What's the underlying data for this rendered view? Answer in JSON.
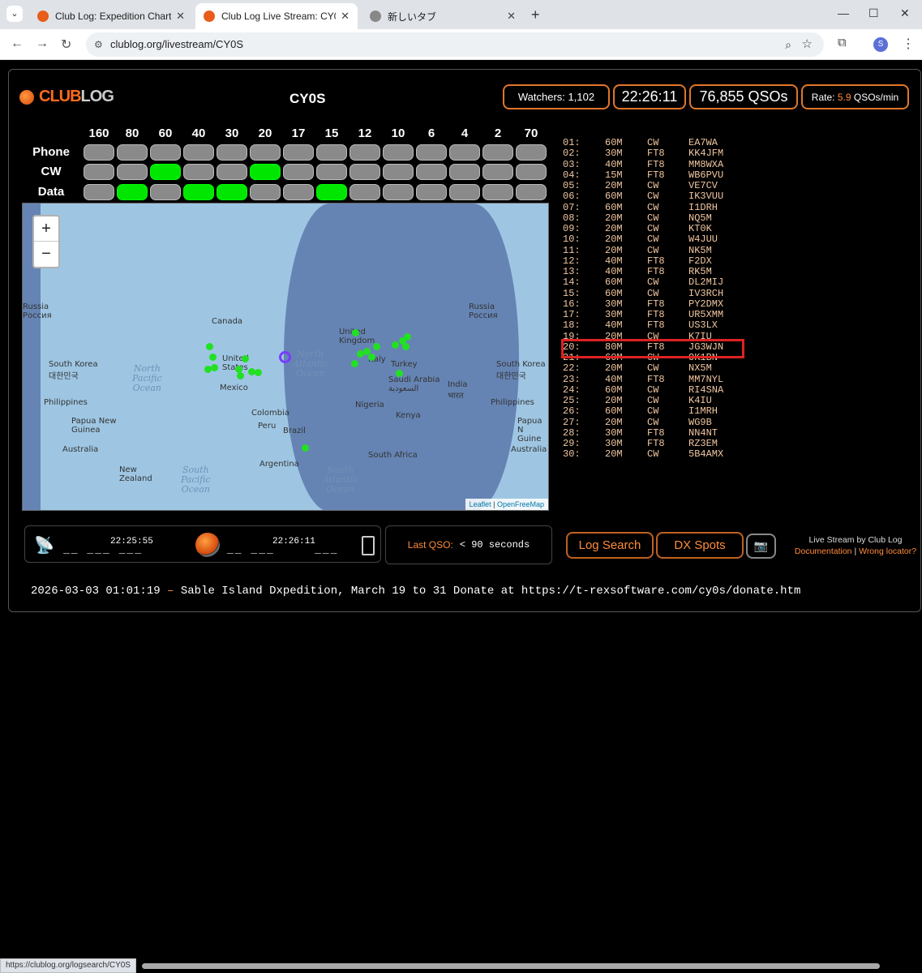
{
  "browser": {
    "tabs": [
      {
        "title": "Club Log: Expedition Charts - C"
      },
      {
        "title": "Club Log Live Stream: CY0S"
      },
      {
        "title": "新しいタブ"
      }
    ],
    "url": "clublog.org/livestream/CY0S",
    "avatar_letter": "S",
    "status_url": "https://clublog.org/logsearch/CY0S"
  },
  "header": {
    "logo_part1": "CLUB",
    "logo_part2": "LOG",
    "callsign": "CY0S",
    "watchers_label": "Watchers:",
    "watchers_value": "1,102",
    "clock": "22:26:11",
    "qso_count": "76,855",
    "qso_unit": "QSOs",
    "rate_label": "Rate:",
    "rate_value": "5.9",
    "rate_unit": "QSOs/min"
  },
  "bands": [
    "160",
    "80",
    "60",
    "40",
    "30",
    "20",
    "17",
    "15",
    "12",
    "10",
    "6",
    "4",
    "2",
    "70"
  ],
  "modes": [
    {
      "label": "Phone",
      "active": []
    },
    {
      "label": "CW",
      "active": [
        "60",
        "20"
      ]
    },
    {
      "label": "Data",
      "active": [
        "80",
        "40",
        "30",
        "15"
      ]
    }
  ],
  "map": {
    "zoom_in": "+",
    "zoom_out": "−",
    "attribution_1": "Leaflet",
    "attribution_sep": "|",
    "attribution_2": "OpenFreeMap",
    "labels": {
      "russia_w": "Russia\nРоссия",
      "south_korea_w": "South Korea\n대한민국",
      "philippines_w": "Philippines",
      "png_w": "Papua New\nGuinea",
      "australia_w": "Australia",
      "new_zealand": "New\nZealand",
      "canada": "Canada",
      "united_states": "United\nStates",
      "mexico": "Mexico",
      "colombia": "Colombia",
      "peru": "Peru",
      "brazil": "Brazil",
      "argentina": "Argentina",
      "united_kingdom": "United\nKingdom",
      "italy": "Italy",
      "turkey": "Turkey",
      "saudi_arabia": "Saudi Arabia\nالسعودية",
      "india": "India\nभारत",
      "nigeria": "Nigeria",
      "kenya": "Kenya",
      "south_africa": "South Africa",
      "russia_e": "Russia\nРоссия",
      "south_korea_e": "South Korea\n대한민국",
      "philippines_e": "Philippines",
      "png_e": "Papua N\nGuine",
      "australia_e": "Australia"
    },
    "oceans": {
      "north_pacific": "North\nPacific\nOcean",
      "south_pacific": "South\nPacific\nOcean",
      "north_atlantic": "North\nAtlantic\nOcean",
      "south_atlantic": "South\nAtlantic\nOcean"
    }
  },
  "qso_log": [
    {
      "n": "01:",
      "band": "60M",
      "mode": "CW",
      "call": "EA7WA"
    },
    {
      "n": "02:",
      "band": "30M",
      "mode": "FT8",
      "call": "KK4JFM"
    },
    {
      "n": "03:",
      "band": "40M",
      "mode": "FT8",
      "call": "MM8WXA"
    },
    {
      "n": "04:",
      "band": "15M",
      "mode": "FT8",
      "call": "WB6PVU"
    },
    {
      "n": "05:",
      "band": "20M",
      "mode": "CW",
      "call": "VE7CV"
    },
    {
      "n": "06:",
      "band": "60M",
      "mode": "CW",
      "call": "IK3VUU"
    },
    {
      "n": "07:",
      "band": "60M",
      "mode": "CW",
      "call": "I1DRH"
    },
    {
      "n": "08:",
      "band": "20M",
      "mode": "CW",
      "call": "NQ5M"
    },
    {
      "n": "09:",
      "band": "20M",
      "mode": "CW",
      "call": "KT0K"
    },
    {
      "n": "10:",
      "band": "20M",
      "mode": "CW",
      "call": "W4JUU"
    },
    {
      "n": "11:",
      "band": "20M",
      "mode": "CW",
      "call": "NK5M"
    },
    {
      "n": "12:",
      "band": "40M",
      "mode": "FT8",
      "call": "F2DX"
    },
    {
      "n": "13:",
      "band": "40M",
      "mode": "FT8",
      "call": "RK5M"
    },
    {
      "n": "14:",
      "band": "60M",
      "mode": "CW",
      "call": "DL2MIJ"
    },
    {
      "n": "15:",
      "band": "60M",
      "mode": "CW",
      "call": "IV3RCH"
    },
    {
      "n": "16:",
      "band": "30M",
      "mode": "FT8",
      "call": "PY2DMX"
    },
    {
      "n": "17:",
      "band": "30M",
      "mode": "FT8",
      "call": "UR5XMM"
    },
    {
      "n": "18:",
      "band": "40M",
      "mode": "FT8",
      "call": "US3LX"
    },
    {
      "n": "19:",
      "band": "20M",
      "mode": "CW",
      "call": "K7IU"
    },
    {
      "n": "20:",
      "band": "80M",
      "mode": "FT8",
      "call": "JG3WJN"
    },
    {
      "n": "21:",
      "band": "60M",
      "mode": "CW",
      "call": "OK1BN"
    },
    {
      "n": "22:",
      "band": "20M",
      "mode": "CW",
      "call": "NX5M"
    },
    {
      "n": "23:",
      "band": "40M",
      "mode": "FT8",
      "call": "MM7NYL"
    },
    {
      "n": "24:",
      "band": "60M",
      "mode": "CW",
      "call": "RI4SNA"
    },
    {
      "n": "25:",
      "band": "20M",
      "mode": "CW",
      "call": "K4IU"
    },
    {
      "n": "26:",
      "band": "60M",
      "mode": "CW",
      "call": "I1MRH"
    },
    {
      "n": "27:",
      "band": "20M",
      "mode": "CW",
      "call": "WG9B"
    },
    {
      "n": "28:",
      "band": "30M",
      "mode": "FT8",
      "call": "NN4NT"
    },
    {
      "n": "29:",
      "band": "30M",
      "mode": "FT8",
      "call": "RZ3EM"
    },
    {
      "n": "30:",
      "band": "20M",
      "mode": "CW",
      "call": "5B4AMX"
    }
  ],
  "stream": {
    "dash_left1": "__ ___ ___",
    "time_left": "22:25:55",
    "dash_right1": "__ ___",
    "time_right": "22:26:11",
    "dash_right2": "___"
  },
  "last_qso": {
    "label": "Last QSO:",
    "value": "< 90 seconds"
  },
  "buttons": {
    "log_search": "Log Search",
    "dx_spots": "DX Spots",
    "camera": "📷"
  },
  "credit": {
    "line1": "Live Stream by Club Log",
    "doc": "Documentation",
    "sep": "|",
    "wrong": "Wrong locator?"
  },
  "news": {
    "date": "2026-03-03 01:01:19",
    "dash": "–",
    "text": "Sable Island Dxpedition, March 19 to 31 Donate at https://t-rexsoftware.com/cy0s/donate.htm"
  }
}
